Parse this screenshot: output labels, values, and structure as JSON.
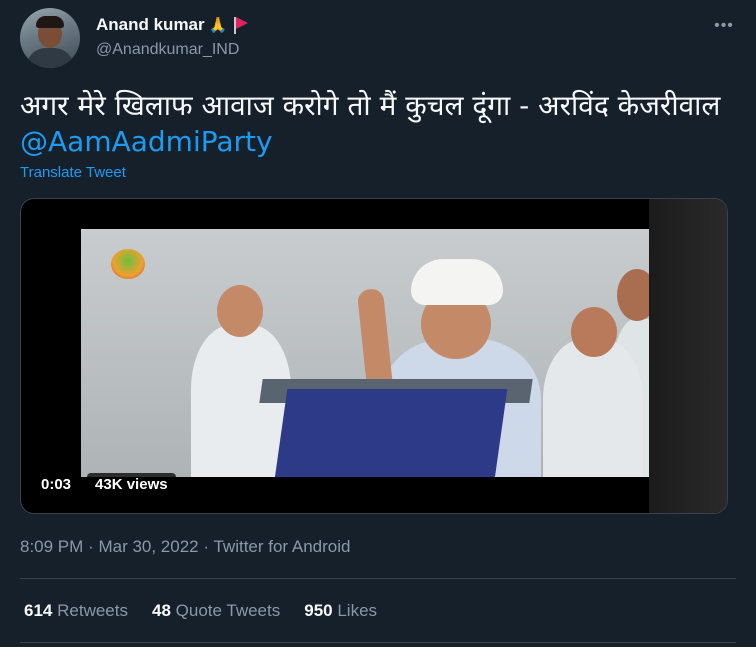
{
  "author": {
    "display_name": "Anand kumar",
    "emoji": "🙏",
    "flag_icon": "red-flag-icon",
    "handle": "@Anandkumar_IND"
  },
  "more_icon": "more-options-icon",
  "tweet": {
    "text": "अगर मेरे खिलाफ आवाज करोगे तो मैं कुचल दूंगा - अरविंद केजरीवाल ",
    "mention": "@AamAadmiParty",
    "translate_label": "Translate Tweet"
  },
  "video": {
    "time": "0:03",
    "views": "43K views"
  },
  "meta": {
    "time": "8:09 PM",
    "date": "Mar 30, 2022",
    "source": "Twitter for Android",
    "separator": "·"
  },
  "stats": [
    {
      "count": "614",
      "label": "Retweets"
    },
    {
      "count": "48",
      "label": "Quote Tweets"
    },
    {
      "count": "950",
      "label": "Likes"
    }
  ],
  "colors": {
    "background": "#15202b",
    "link": "#1d9bf0",
    "secondary_text": "#8b98a5",
    "border": "#38444d"
  }
}
